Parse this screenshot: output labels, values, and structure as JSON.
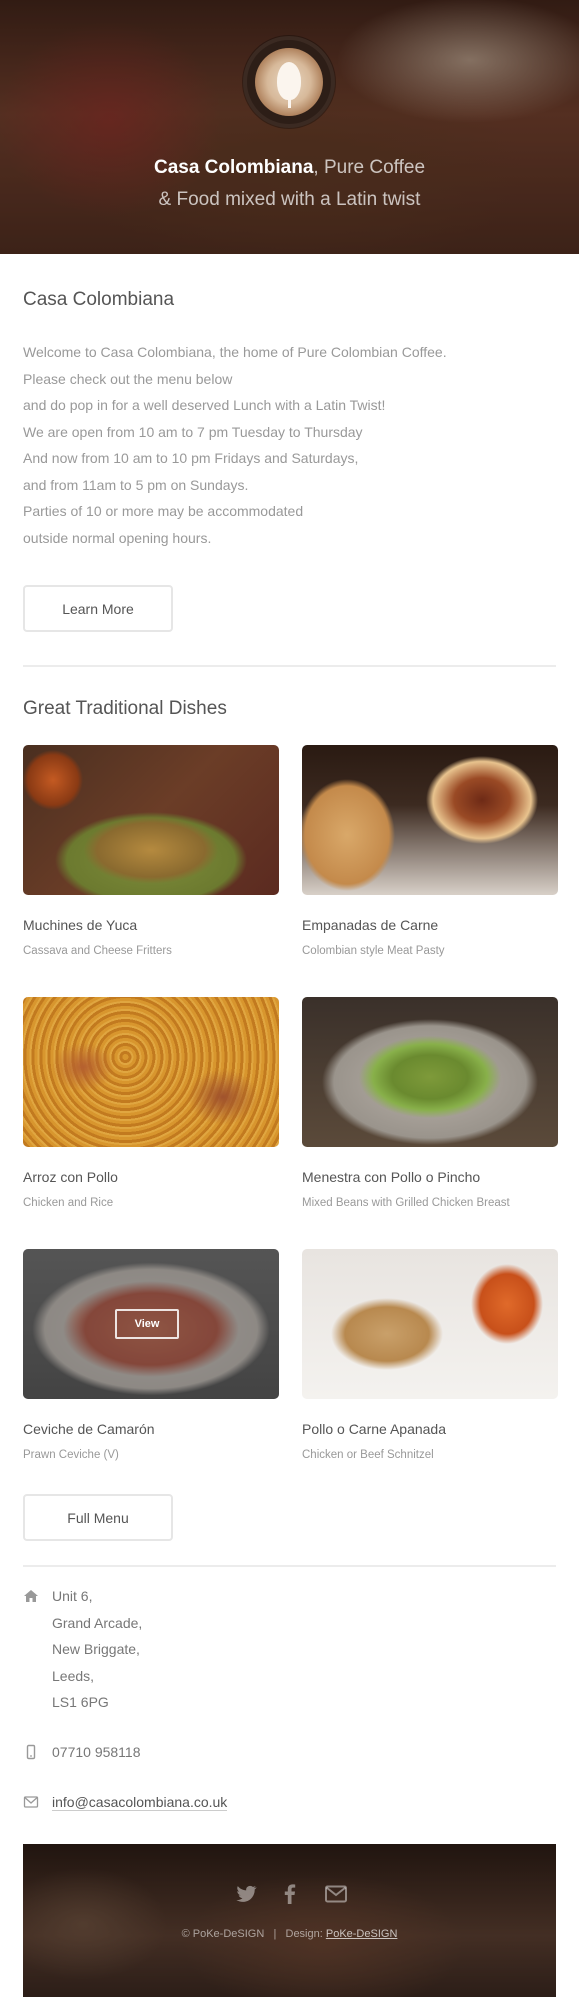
{
  "hero": {
    "brand": "Casa Colombiana",
    "tagline_rest": ", Pure Coffee",
    "tagline_line2": "& Food mixed with a Latin twist"
  },
  "intro": {
    "title": "Casa Colombiana",
    "lines": [
      "Welcome to Casa Colombiana, the home of Pure Colombian Coffee.",
      "Please check out the menu below",
      "and do pop in for a well deserved Lunch with a Latin Twist!",
      "We are open from 10 am to 7 pm Tuesday to Thursday",
      "And now from 10 am to 10 pm Fridays and Saturdays,",
      "and from 11am to 5 pm on Sundays.",
      "Parties of 10 or more may be accommodated",
      "outside normal opening hours."
    ],
    "button": "Learn More"
  },
  "dishes": {
    "title": "Great Traditional Dishes",
    "items": [
      {
        "name": "Muchines de Yuca",
        "desc": "Cassava and Cheese Fritters"
      },
      {
        "name": "Empanadas de Carne",
        "desc": "Colombian style Meat Pasty"
      },
      {
        "name": "Arroz con Pollo",
        "desc": "Chicken and Rice"
      },
      {
        "name": "Menestra con Pollo o Pincho",
        "desc": "Mixed Beans with Grilled Chicken Breast"
      },
      {
        "name": "Ceviche de Camarón",
        "desc": "Prawn Ceviche (V)"
      },
      {
        "name": "Pollo o Carne Apanada",
        "desc": "Chicken or Beef Schnitzel"
      }
    ],
    "view_label": "View",
    "button": "Full Menu"
  },
  "contact": {
    "address": [
      "Unit 6,",
      "Grand Arcade,",
      "New Briggate,",
      "Leeds,",
      "LS1 6PG"
    ],
    "phone": "07710 958118",
    "email": "info@casacolombiana.co.uk"
  },
  "footer": {
    "copyright": "© PoKe-DeSIGN",
    "separator": "|",
    "design_label": "Design:",
    "design_link": "PoKe-DeSIGN"
  }
}
